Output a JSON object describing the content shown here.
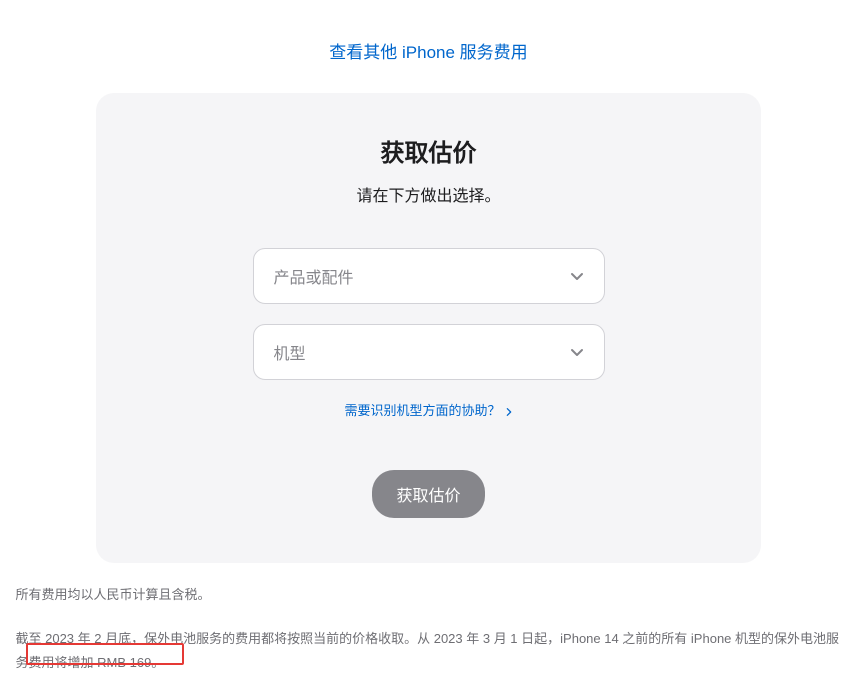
{
  "topLink": "查看其他 iPhone 服务费用",
  "card": {
    "title": "获取估价",
    "subtitle": "请在下方做出选择。",
    "select1": "产品或配件",
    "select2": "机型",
    "helpLink": "需要识别机型方面的协助？",
    "submit": "获取估价"
  },
  "footnote1": "所有费用均以人民币计算且含税。",
  "footnote2": "截至 2023 年 2 月底，保外电池服务的费用都将按照当前的价格收取。从 2023 年 3 月 1 日起，iPhone 14 之前的所有 iPhone 机型的保外电池服务费用将增加 RMB 169。"
}
